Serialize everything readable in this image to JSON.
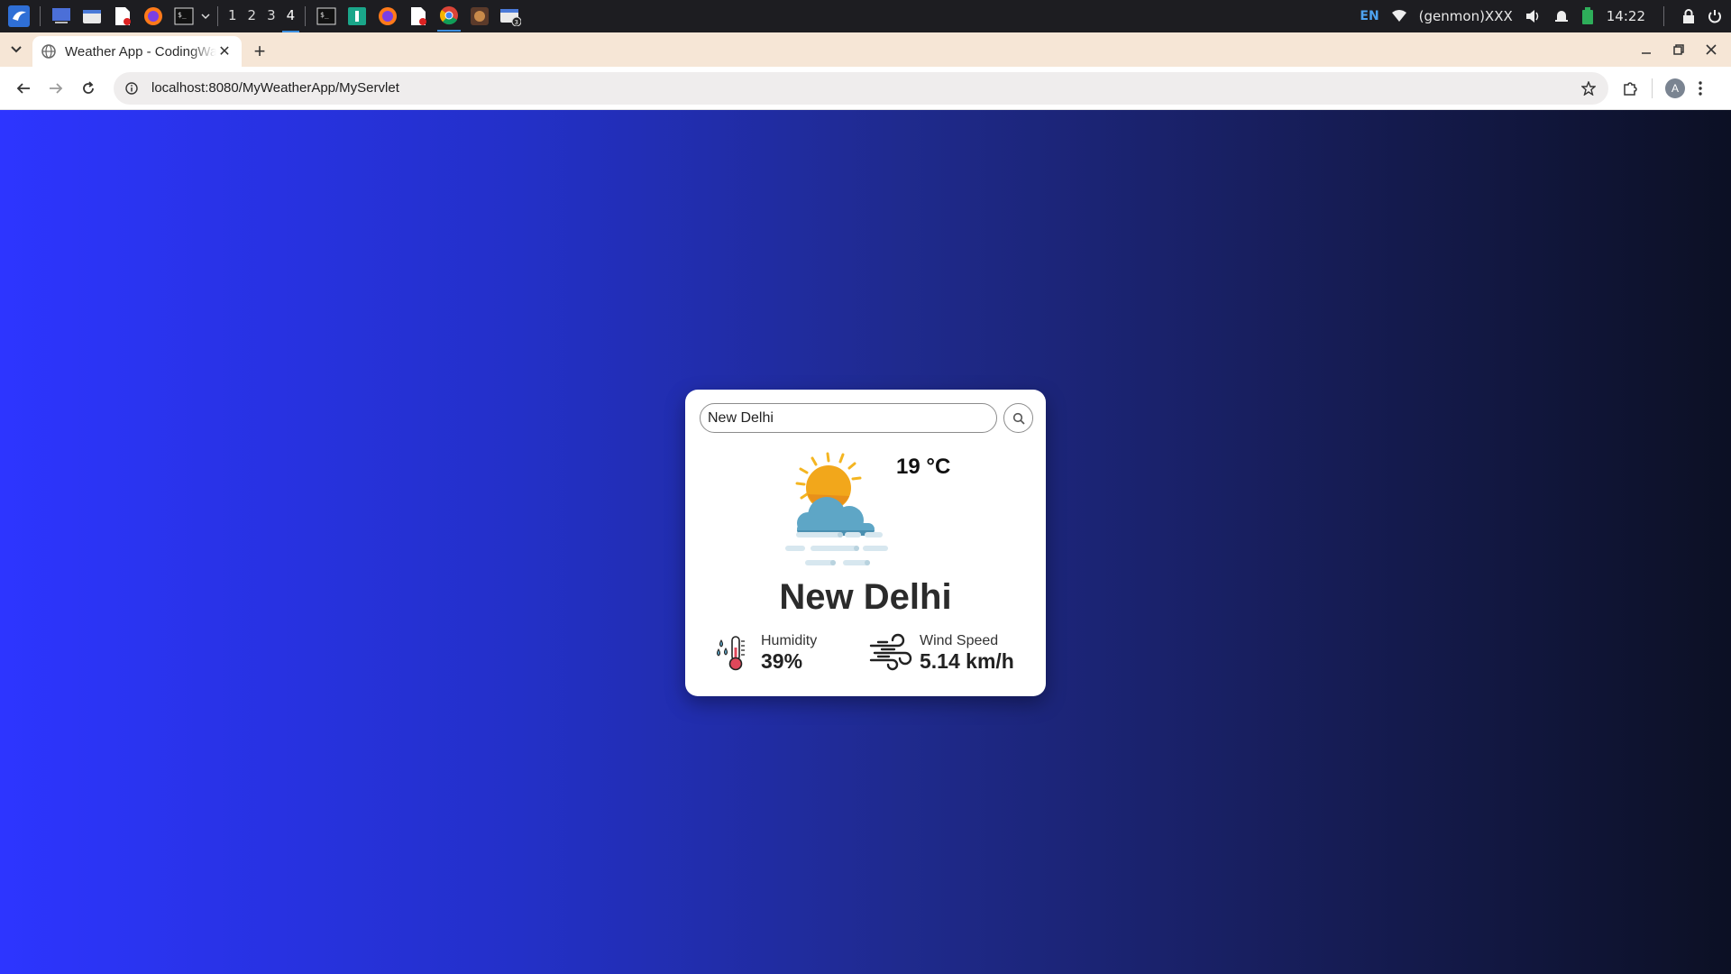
{
  "taskbar": {
    "workspaces": [
      "1",
      "2",
      "3",
      "4"
    ],
    "active_workspace": "4",
    "language": "EN",
    "network_label": "(genmon)XXX",
    "clock": "14:22",
    "icons": [
      "app-menu-icon",
      "desktop-icon",
      "file-manager-icon",
      "text-editor-icon",
      "firefox-icon",
      "terminal-icon",
      "terminal-icon",
      "pycharm-icon",
      "firefox-icon",
      "document-icon",
      "chrome-icon",
      "app-icon",
      "files-icon"
    ]
  },
  "browser": {
    "tab_title": "Weather App - CodingWala",
    "url": "localhost:8080/MyWeatherApp/MyServlet",
    "profile_initial": "A",
    "tab_close": "✕",
    "new_tab": "+"
  },
  "weather": {
    "search_value": "New Delhi",
    "temperature": "19 °C",
    "city": "New Delhi",
    "humidity_label": "Humidity",
    "humidity_value": "39%",
    "wind_label": "Wind Speed",
    "wind_value": "5.14 km/h",
    "condition_icon": "sun-cloud-mist-icon"
  },
  "colors": {
    "gradient_start": "#2d35ff",
    "gradient_end": "#0c1024",
    "card_bg": "#ffffff"
  }
}
